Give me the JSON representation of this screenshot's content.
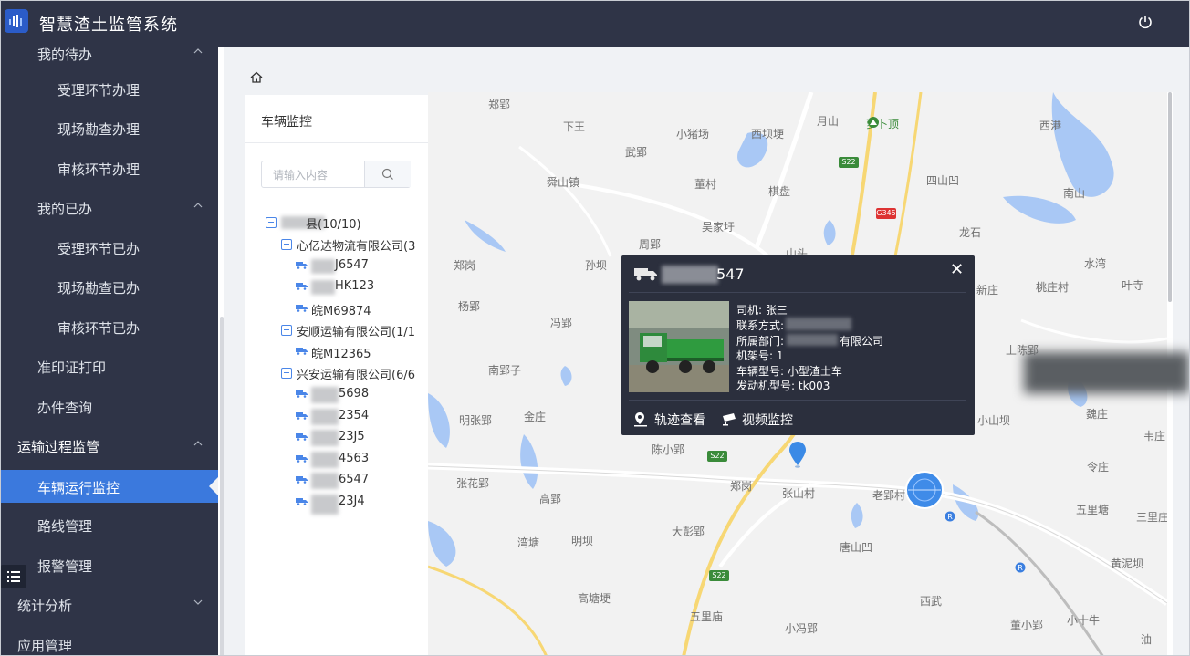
{
  "app": {
    "title": "智慧渣土监管系统"
  },
  "colors": {
    "sidebar_bg": "#2f3447",
    "active_item": "#3b79dd",
    "popup_bg": "#2b2f3d",
    "accent": "#4a86e8"
  },
  "sidebar": {
    "items": [
      {
        "label": "我的待办",
        "level": 1,
        "expanded": true
      },
      {
        "label": "受理环节办理",
        "level": 2
      },
      {
        "label": "现场勘查办理",
        "level": 2
      },
      {
        "label": "审核环节办理",
        "level": 2
      },
      {
        "label": "我的已办",
        "level": 1,
        "expanded": true
      },
      {
        "label": "受理环节已办",
        "level": 2
      },
      {
        "label": "现场勘查已办",
        "level": 2
      },
      {
        "label": "审核环节已办",
        "level": 2
      },
      {
        "label": "准印证打印",
        "level": 1
      },
      {
        "label": "办件查询",
        "level": 1
      },
      {
        "label": "运输过程监管",
        "level": 0,
        "expanded": true
      },
      {
        "label": "车辆运行监控",
        "level": 1,
        "active": true
      },
      {
        "label": "路线管理",
        "level": 1
      },
      {
        "label": "报警管理",
        "level": 1
      },
      {
        "label": "统计分析",
        "level": 0,
        "expanded": false
      },
      {
        "label": "应用管理",
        "level": 0
      }
    ]
  },
  "panel": {
    "title": "车辆监控",
    "search_placeholder": "请输入内容",
    "tree": {
      "root": "县(10/10)",
      "groups": [
        {
          "name": "心亿达物流有限公司(3",
          "vehicles": [
            "J6547",
            "HK123",
            "皖M69874"
          ]
        },
        {
          "name": "安顺运输有限公司(1/1",
          "vehicles": [
            "皖M12365"
          ]
        },
        {
          "name": "兴安运输有限公司(6/6",
          "vehicles": [
            "5698",
            "2354",
            "23J5",
            "4563",
            "6547",
            "23J4"
          ]
        }
      ]
    }
  },
  "map": {
    "places": [
      "郑郢",
      "下王",
      "小猪场",
      "西坝埂",
      "月山",
      "萝卜顶",
      "西港",
      "武郢",
      "舜山镇",
      "董村",
      "棋盘",
      "四山凹",
      "南山",
      "吴家圩",
      "龙石",
      "周郢",
      "山头",
      "郑岗",
      "孙坝",
      "水湾",
      "杨郢",
      "桃庄村",
      "叶寺",
      "新庄",
      "冯郢",
      "上陈郢",
      "南郢子",
      "明张郢",
      "金庄",
      "小山坝",
      "魏庄",
      "韦庄",
      "陈小郢",
      "令庄",
      "张花郢",
      "高郢",
      "郑岗",
      "张山村",
      "老郢村",
      "五里塘",
      "三里庄",
      "大彭郢",
      "湾塘",
      "明坝",
      "唐山凹",
      "黄泥坝",
      "高塘埂",
      "五里庙",
      "西武",
      "小冯郢",
      "董小郢",
      "小十牛",
      "油"
    ],
    "road_shields": [
      "S22",
      "G345",
      "S22",
      "S22"
    ]
  },
  "popup": {
    "plate_suffix": "547",
    "driver": "司机: 张三",
    "contact": "联系方式:",
    "dept_prefix": "所属部门:",
    "dept_suffix": "有限公司",
    "frame_no": "机架号: 1",
    "model": "车辆型号: 小型渣土车",
    "engine": "发动机型号: tk003",
    "btn_track": "轨迹查看",
    "btn_video": "视频监控"
  }
}
